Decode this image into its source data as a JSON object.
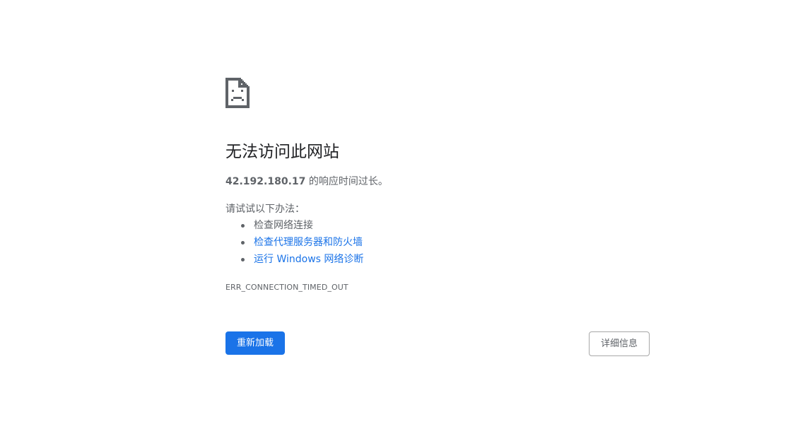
{
  "error": {
    "icon": "sad-page-icon",
    "title": "无法访问此网站",
    "host": "42.192.180.17",
    "summary_suffix": " 的响应时间过长。",
    "suggestions_heading": "请试试以下办法：",
    "suggestions": [
      {
        "label": "检查网络连接",
        "is_link": false
      },
      {
        "label": "检查代理服务器和防火墙",
        "is_link": true
      },
      {
        "label": "运行 Windows 网络诊断",
        "is_link": true
      }
    ],
    "code": "ERR_CONNECTION_TIMED_OUT"
  },
  "buttons": {
    "reload_label": "重新加载",
    "details_label": "详细信息"
  },
  "colors": {
    "primary": "#1a73e8",
    "text": "#5f6368",
    "title": "#202124"
  }
}
